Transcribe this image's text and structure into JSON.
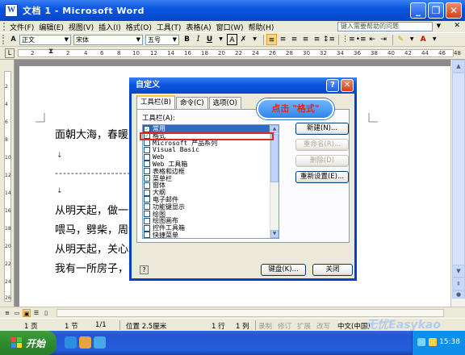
{
  "window": {
    "title": "文档 1 - Microsoft Word",
    "icon_letter": "W"
  },
  "menubar": {
    "items": [
      "文件(F)",
      "编辑(E)",
      "视图(V)",
      "插入(I)",
      "格式(O)",
      "工具(T)",
      "表格(A)",
      "窗口(W)",
      "帮助(H)"
    ],
    "help_placeholder": "键入需要帮助的问题"
  },
  "toolbar": {
    "style": "正文",
    "font": "宋体",
    "size": "五号",
    "bold": "B",
    "italic": "I",
    "underline": "U",
    "char_border": "A",
    "font_color": "A"
  },
  "ruler": {
    "numbers": [
      "2",
      "2",
      "4",
      "6",
      "8",
      "10",
      "12",
      "14",
      "16",
      "18",
      "20",
      "22",
      "24",
      "26",
      "28",
      "30",
      "32",
      "34",
      "36",
      "38",
      "40",
      "42",
      "44",
      "46",
      "48"
    ]
  },
  "vruler": {
    "numbers": [
      "2",
      "4",
      "6",
      "8",
      "10",
      "12",
      "14",
      "16",
      "18",
      "20",
      "22",
      "24",
      "26"
    ]
  },
  "document": {
    "lines": [
      "面朝大海，春暖花",
      "从明天起，做一个",
      "喂马，劈柴，周游",
      "从明天起，关心粮",
      "我有一所房子，面"
    ],
    "para_mark": "↓",
    "dashes": "-------------------------"
  },
  "status": {
    "page": "1 页",
    "section": "1 节",
    "pages": "1/1",
    "position": "位置 2.5厘米",
    "line": "1 行",
    "col": "1 列",
    "rec": "录制",
    "trk": "修订",
    "ext": "扩展",
    "ovr": "改写",
    "lang": "中文(中国)",
    "watermark": "无忧Easykao"
  },
  "taskbar": {
    "start": "开始",
    "clock": "15:38"
  },
  "dialog": {
    "title": "自定义",
    "help": "?",
    "close": "✕",
    "tabs": [
      "工具栏(B)",
      "命令(C)",
      "选项(O)"
    ],
    "list_label": "工具栏(A):",
    "toolbars": [
      {
        "label": "常用",
        "checked": true,
        "selected": true
      },
      {
        "label": "格式",
        "checked": true,
        "selected": false
      },
      {
        "label": "Microsoft 产品系列",
        "checked": false,
        "selected": false
      },
      {
        "label": "Visual Basic",
        "checked": false,
        "selected": false
      },
      {
        "label": "Web",
        "checked": false,
        "selected": false
      },
      {
        "label": "Web 工具箱",
        "checked": false,
        "selected": false
      },
      {
        "label": "表格和边框",
        "checked": false,
        "selected": false
      },
      {
        "label": "菜单栏",
        "checked": true,
        "selected": false
      },
      {
        "label": "窗体",
        "checked": false,
        "selected": false
      },
      {
        "label": "大纲",
        "checked": false,
        "selected": false
      },
      {
        "label": "电子邮件",
        "checked": false,
        "selected": false
      },
      {
        "label": "功能键显示",
        "checked": false,
        "selected": false
      },
      {
        "label": "绘图",
        "checked": false,
        "selected": false
      },
      {
        "label": "绘图画布",
        "checked": false,
        "selected": false
      },
      {
        "label": "控件工具箱",
        "checked": false,
        "selected": false
      },
      {
        "label": "快捷菜单",
        "checked": false,
        "selected": false
      }
    ],
    "buttons": {
      "new": "新建(N)...",
      "rename": "重命名(R)...",
      "delete": "删除(D)",
      "reset": "重新设置(E)...",
      "keyboard": "键盘(K)...",
      "close": "关闭"
    }
  },
  "callout": "点击 \"格式\""
}
